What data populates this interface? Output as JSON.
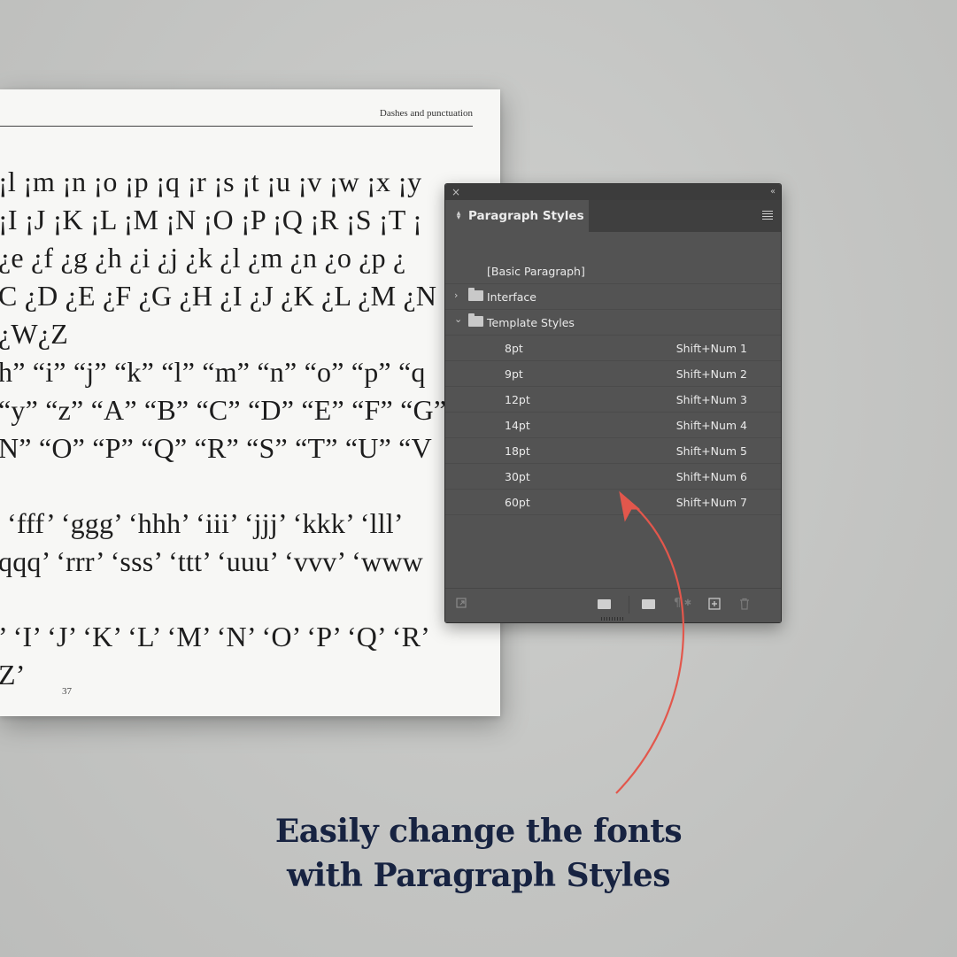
{
  "document": {
    "running_head": "Dashes and punctuation",
    "page_number": "37",
    "glyph_lines": [
      "¡l ¡m ¡n ¡o ¡p ¡q ¡r ¡s ¡t ¡u ¡v ¡w ¡x ¡y",
      "¡I ¡J ¡K ¡L ¡M ¡N ¡O ¡P ¡Q ¡R ¡S ¡T ¡",
      "¿e ¿f ¿g ¿h ¿i ¿j ¿k ¿l ¿m ¿n ¿o ¿p ¿",
      "C ¿D ¿E ¿F ¿G ¿H ¿I ¿J ¿K ¿L ¿M ¿N",
      "¿W¿Z",
      "h” “i” “j” “k” “l” “m” “n” “o” “p” “q",
      "“y” “z” “A” “B” “C” “D” “E” “F” “G”",
      "N” “O” “P” “Q” “R” “S” “T” “U” “V",
      "‘fff’ ‘ggg’ ‘hhh’ ‘iii’ ‘jjj’ ‘kkk’ ‘lll’",
      "qqq’ ‘rrr’ ‘sss’ ‘ttt’ ‘uuu’ ‘vvv’ ‘www",
      "’ ‘I’ ‘J’ ‘K’ ‘L’ ‘M’ ‘N’ ‘O’ ‘P’ ‘Q’ ‘R’",
      "Z’"
    ]
  },
  "panel": {
    "close_glyph": "×",
    "collapse_glyph": "‹‹",
    "tab_title": "Paragraph Styles",
    "styles": [
      {
        "name": "[Basic Paragraph]",
        "shortcut": ""
      },
      {
        "name": "Interface",
        "shortcut": "",
        "group": "collapsed",
        "icon": "folder-icon"
      },
      {
        "name": "Template Styles",
        "shortcut": "",
        "group": "expanded",
        "icon": "folder-icon"
      },
      {
        "name": "8pt",
        "shortcut": "Shift+Num 1"
      },
      {
        "name": "9pt",
        "shortcut": "Shift+Num 2"
      },
      {
        "name": "12pt",
        "shortcut": "Shift+Num 3"
      },
      {
        "name": "14pt",
        "shortcut": "Shift+Num 4"
      },
      {
        "name": "18pt",
        "shortcut": "Shift+Num 5"
      },
      {
        "name": "30pt",
        "shortcut": "Shift+Num 6"
      },
      {
        "name": "60pt",
        "shortcut": "Shift+Num 7"
      }
    ],
    "bottom_icons": [
      "style-override-icon",
      "load-styles-icon",
      "new-group-icon",
      "clear-overrides-icon",
      "new-style-icon",
      "delete-icon"
    ]
  },
  "caption": {
    "line1": "Easily change the fonts",
    "line2": "with Paragraph Styles"
  },
  "colors": {
    "panel_bg": "#535353",
    "arrow": "#e2574c",
    "caption": "#172341"
  }
}
